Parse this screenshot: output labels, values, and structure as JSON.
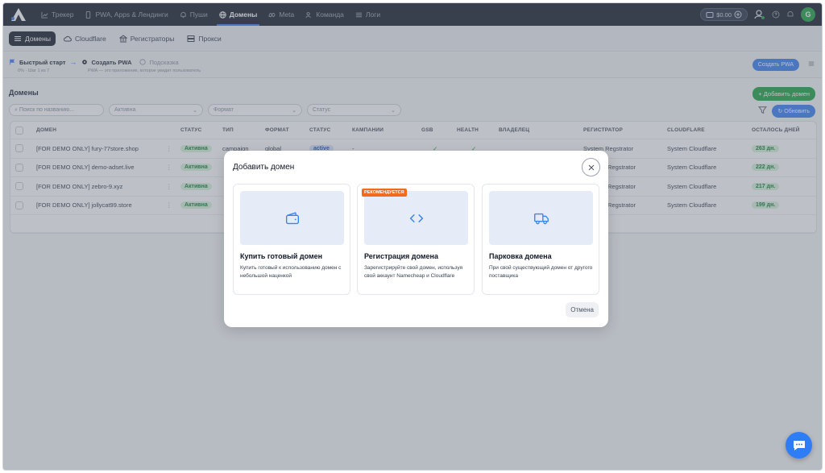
{
  "nav": {
    "items": [
      {
        "label": "Трекер",
        "icon": "chart-line-icon"
      },
      {
        "label": "PWA, Apps & Лендинги",
        "icon": "phone-icon"
      },
      {
        "label": "Пуши",
        "icon": "bell-icon"
      },
      {
        "label": "Домены",
        "icon": "globe-icon",
        "active": true
      },
      {
        "label": "Meta",
        "icon": "meta-icon"
      },
      {
        "label": "Команда",
        "icon": "team-icon"
      },
      {
        "label": "Логи",
        "icon": "list-icon"
      }
    ],
    "balance": "$0.00",
    "avatar_letter": "G"
  },
  "subnav": {
    "tabs": [
      {
        "label": "Домены",
        "active": true
      },
      {
        "label": "Cloudflare"
      },
      {
        "label": "Регистраторы"
      },
      {
        "label": "Прокси"
      }
    ]
  },
  "quickstart": {
    "title": "Быстрый старт",
    "step_label": "Создать PWA",
    "hint_label": "Подсказка",
    "progress_text": "0% · Шаг 1 из 7",
    "hint_text": "PWA — это приложение, которое увидит пользователь",
    "create_button": "Создать PWA"
  },
  "domains": {
    "title": "Домены",
    "add_button": "Добавить домен",
    "refresh_button": "Обновить",
    "search_placeholder": "Поиск по названию...",
    "filter_status": "Активна",
    "filter_format": "Формат",
    "filter_status2": "Статус",
    "columns": [
      "ДОМЕН",
      "СТАТУС",
      "ТИП",
      "ФОРМАТ",
      "СТАТУС",
      "КАМПАНИИ",
      "GSB",
      "HEALTH",
      "ВЛАДЕЛЕЦ",
      "РЕГИСТРАТОР",
      "CLOUDFLARE",
      "ОСТАЛОСЬ ДНЕЙ"
    ],
    "rows": [
      {
        "domain": "[FOR DEMO ONLY] fury-77store.shop",
        "status": "Активна",
        "type": "campaign",
        "format": "global",
        "status2": "active",
        "campaigns": "-",
        "registrar": "System Regstrator",
        "cloudflare": "System Cloudflare",
        "days": "263 дн."
      },
      {
        "domain": "[FOR DEMO ONLY] demo-adset.live",
        "status": "Активна",
        "registrar": "Regstrator",
        "cloudflare": "System Cloudflare",
        "days": "222 дн."
      },
      {
        "domain": "[FOR DEMO ONLY] zebro-9.xyz",
        "status": "Активна",
        "registrar": "Regstrator",
        "cloudflare": "System Cloudflare",
        "days": "217 дн."
      },
      {
        "domain": "[FOR DEMO ONLY] jollycat99.store",
        "status": "Активна",
        "registrar": "Regstrator",
        "cloudflare": "System Cloudflare",
        "days": "199 дн."
      }
    ]
  },
  "modal": {
    "title": "Добавить домен",
    "cards": [
      {
        "title": "Купить готовый домен",
        "desc": "Купить готовый к использованию домен с небольшой наценкой",
        "icon": "wallet-icon"
      },
      {
        "title": "Регистрация домена",
        "desc": "Зарегистрируйте свой домен, используя свой аккаунт Namecheap и Cloudflare",
        "icon": "code-icon",
        "badge": "РЕКОМЕНДУЕТСЯ"
      },
      {
        "title": "Парковка домена",
        "desc": "При свой существующий домен от другого поставщика",
        "icon": "truck-icon"
      }
    ],
    "cancel_button": "Отмена"
  },
  "colors": {
    "accent": "#3b82f6",
    "green": "#22a447",
    "nav_bg": "#1b2330",
    "badge_orange": "#f26a1b"
  }
}
